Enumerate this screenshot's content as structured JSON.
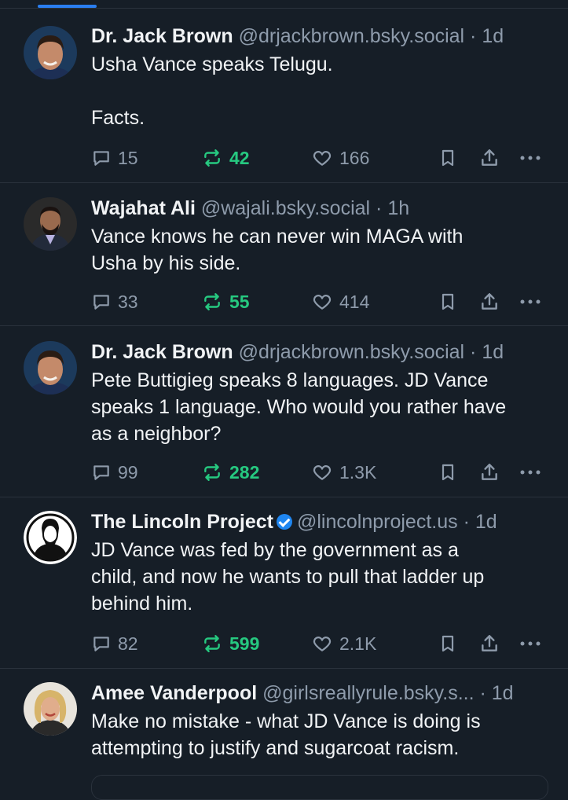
{
  "posts": [
    {
      "name": "Dr. Jack Brown",
      "handle": "@drjackbrown.bsky.social",
      "sep": " · ",
      "time": "1d",
      "text": "Usha Vance speaks Telugu.\n\nFacts.",
      "replies": "15",
      "reposts": "42",
      "likes": "166",
      "avatar": "man-dark-hair-photo"
    },
    {
      "name": "Wajahat Ali",
      "handle": "@wajali.bsky.social",
      "sep": " · ",
      "time": "1h",
      "text": "Vance knows he can never win MAGA with\nUsha by his side.",
      "replies": "33",
      "reposts": "55",
      "likes": "414",
      "avatar": "man-beard-suit-photo"
    },
    {
      "name": "Dr. Jack Brown",
      "handle": "@drjackbrown.bsky.social",
      "sep": " · ",
      "time": "1d",
      "text": "Pete Buttigieg speaks 8 languages. JD Vance\nspeaks 1 language. Who would you rather have\nas a neighbor?",
      "replies": "99",
      "reposts": "282",
      "likes": "1.3K",
      "avatar": "man-dark-hair-photo"
    },
    {
      "name": "The Lincoln Project",
      "handle": "@lincolnproject.us",
      "sep": " · ",
      "time": "1d",
      "text": "JD Vance was fed by the government as a\nchild, and now he wants to pull that ladder up\nbehind him.",
      "replies": "82",
      "reposts": "599",
      "likes": "2.1K",
      "avatar": "lincoln-logo",
      "verified": true
    },
    {
      "name": "Amee Vanderpool",
      "handle": "@girlsreallyrule.bsky.s...",
      "sep": " · ",
      "time": "1d",
      "text": "Make no mistake - what JD Vance is doing is\nattempting to justify and sugarcoat racism.",
      "avatar": "woman-blonde-photo"
    }
  ],
  "colors": {
    "background": "#161e27",
    "accent": "#2a7ef0",
    "repost": "#26c980",
    "muted": "#8e9bab"
  }
}
